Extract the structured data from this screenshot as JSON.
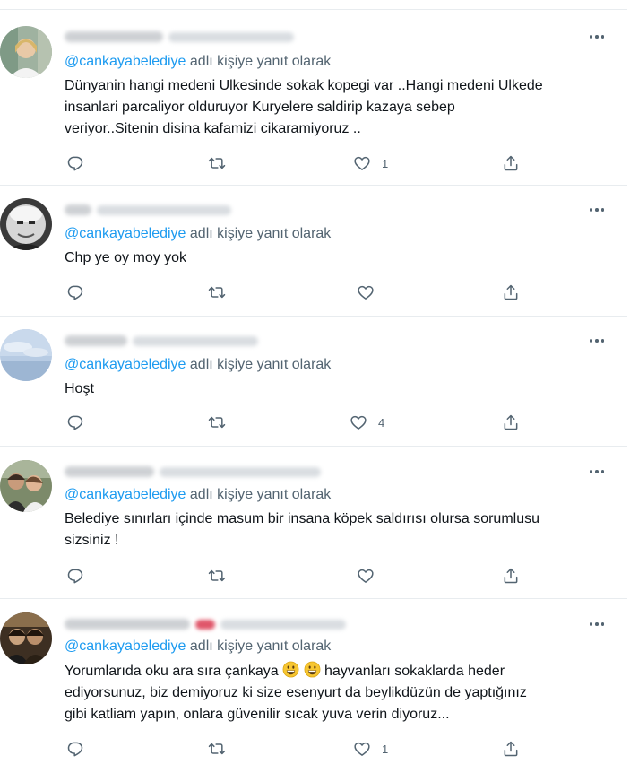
{
  "reply_prefix_text": "adlı kişiye yanıt olarak",
  "tweets": [
    {
      "mention": "@cankayabelediye",
      "text": "Dünyanin hangi medeni Ulkesinde sokak kopegi var ..Hangi medeni Ulkede\ninsanlari parcaliyor olduruyor Kuryelere saldirip kazaya sebep\nveriyor..Sitenin disina kafamizi cikaramiyoruz ..",
      "likes": "1"
    },
    {
      "mention": "@cankayabelediye",
      "text": "Chp ye oy moy yok",
      "likes": ""
    },
    {
      "mention": "@cankayabelediye",
      "text": "Hoşt",
      "likes": "4"
    },
    {
      "mention": "@cankayabelediye",
      "text": "Belediye sınırları içinde masum bir insana köpek saldırısı olursa sorumlusu\nsizsiniz !",
      "likes": ""
    },
    {
      "mention": "@cankayabelediye",
      "text_before_emoji": "Yorumlarıda oku ara sıra çankaya",
      "text_after_emoji": "hayvanları sokaklarda heder\nediyorsunuz, biz demiyoruz ki size esenyurt da beylikdüzün de  yaptığınız\ngibi katliam yapın, onlara güvenilir sıcak yuva verin diyoruz...",
      "likes": "1"
    }
  ],
  "icons": {
    "reply": "reply-icon",
    "retweet": "retweet-icon",
    "like": "heart-icon",
    "share": "share-icon",
    "more": "more-icon"
  },
  "colors": {
    "link": "#1d9bf0",
    "secondary": "#536471",
    "text": "#0f1419",
    "divider": "#e8ecef"
  }
}
